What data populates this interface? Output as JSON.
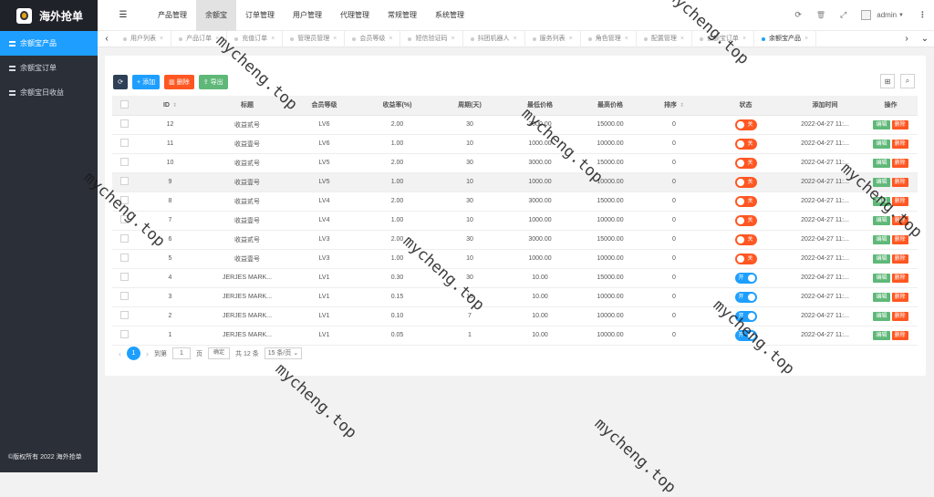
{
  "app": {
    "logo_text": "海外抢单",
    "copyright": "©版权所有 2022 海外抢单"
  },
  "sidebar": {
    "items": [
      {
        "label": "余额宝产品",
        "icon": "list-icon",
        "active": true
      },
      {
        "label": "余额宝订单",
        "icon": "list-icon",
        "active": false
      },
      {
        "label": "余额宝日收益",
        "icon": "list-icon",
        "active": false
      }
    ]
  },
  "topnav": {
    "menu_icon": "☰",
    "items": [
      "产品管理",
      "余额宝",
      "订单管理",
      "用户管理",
      "代理管理",
      "常规管理",
      "系统管理"
    ],
    "active_index": 1
  },
  "top_tools": {
    "refresh": "⟳",
    "clear": "🗑",
    "fullscreen": "⤢",
    "user": "admin",
    "more": "⋮"
  },
  "tabs": {
    "items": [
      "用户列表",
      "产品订单",
      "充值订单",
      "管理员管理",
      "会员等级",
      "短信验证码",
      "抖团机器人",
      "服务列表",
      "角色管理",
      "配置管理",
      "余额宝订单",
      "余额宝产品"
    ],
    "active_index": 11,
    "close": "×",
    "prev": "‹",
    "next": "›",
    "dropdown": "⌄"
  },
  "toolbar": {
    "refresh": "⟳",
    "add": "添加",
    "delete": "删除",
    "export": "导出"
  },
  "right_tools": {
    "columns": "⊞",
    "search": "⌕"
  },
  "table": {
    "columns": [
      "ID",
      "标题",
      "会员等级",
      "收益率(%)",
      "周期(天)",
      "最低价格",
      "最高价格",
      "排序",
      "状态",
      "添加时间",
      "操作"
    ],
    "rows": [
      {
        "id": "12",
        "title": "收益贰号",
        "level": "LV6",
        "rate": "2.00",
        "days": "30",
        "min": "3000.00",
        "max": "15000.00",
        "sort": "0",
        "status": "关",
        "on": false,
        "time": "2022-04-27 11:..."
      },
      {
        "id": "11",
        "title": "收益壹号",
        "level": "LV6",
        "rate": "1.00",
        "days": "10",
        "min": "1000.00",
        "max": "10000.00",
        "sort": "0",
        "status": "关",
        "on": false,
        "time": "2022-04-27 11:..."
      },
      {
        "id": "10",
        "title": "收益贰号",
        "level": "LV5",
        "rate": "2.00",
        "days": "30",
        "min": "3000.00",
        "max": "15000.00",
        "sort": "0",
        "status": "关",
        "on": false,
        "time": "2022-04-27 11:..."
      },
      {
        "id": "9",
        "title": "收益壹号",
        "level": "LV5",
        "rate": "1.00",
        "days": "10",
        "min": "1000.00",
        "max": "10000.00",
        "sort": "0",
        "status": "关",
        "on": false,
        "time": "2022-04-27 11:..."
      },
      {
        "id": "8",
        "title": "收益贰号",
        "level": "LV4",
        "rate": "2.00",
        "days": "30",
        "min": "3000.00",
        "max": "15000.00",
        "sort": "0",
        "status": "关",
        "on": false,
        "time": "2022-04-27 11:..."
      },
      {
        "id": "7",
        "title": "收益壹号",
        "level": "LV4",
        "rate": "1.00",
        "days": "10",
        "min": "1000.00",
        "max": "10000.00",
        "sort": "0",
        "status": "关",
        "on": false,
        "time": "2022-04-27 11:..."
      },
      {
        "id": "6",
        "title": "收益贰号",
        "level": "LV3",
        "rate": "2.00",
        "days": "30",
        "min": "3000.00",
        "max": "15000.00",
        "sort": "0",
        "status": "关",
        "on": false,
        "time": "2022-04-27 11:..."
      },
      {
        "id": "5",
        "title": "收益壹号",
        "level": "LV3",
        "rate": "1.00",
        "days": "10",
        "min": "1000.00",
        "max": "10000.00",
        "sort": "0",
        "status": "关",
        "on": false,
        "time": "2022-04-27 11:..."
      },
      {
        "id": "4",
        "title": "JERJES MARK...",
        "level": "LV1",
        "rate": "0.30",
        "days": "30",
        "min": "10.00",
        "max": "15000.00",
        "sort": "0",
        "status": "开",
        "on": true,
        "time": "2022-04-27 11:..."
      },
      {
        "id": "3",
        "title": "JERJES MARK...",
        "level": "LV1",
        "rate": "0.15",
        "days": "15",
        "min": "10.00",
        "max": "10000.00",
        "sort": "0",
        "status": "开",
        "on": true,
        "time": "2022-04-27 11:..."
      },
      {
        "id": "2",
        "title": "JERJES MARK...",
        "level": "LV1",
        "rate": "0.10",
        "days": "7",
        "min": "10.00",
        "max": "10000.00",
        "sort": "0",
        "status": "开",
        "on": true,
        "time": "2022-04-27 11:..."
      },
      {
        "id": "1",
        "title": "JERJES MARK...",
        "level": "LV1",
        "rate": "0.05",
        "days": "1",
        "min": "10.00",
        "max": "10000.00",
        "sort": "0",
        "status": "开",
        "on": true,
        "time": "2022-04-27 11:..."
      }
    ],
    "highlight_row": 3,
    "edit_label": "编辑",
    "delete_label": "删除"
  },
  "pager": {
    "current": "1",
    "goto_label": "到第",
    "page_value": "1",
    "page_unit": "页",
    "confirm": "确定",
    "total": "共 12 条",
    "per_page": "15 条/页",
    "prev": "‹",
    "next": "›"
  },
  "watermark": "mycheng.top"
}
